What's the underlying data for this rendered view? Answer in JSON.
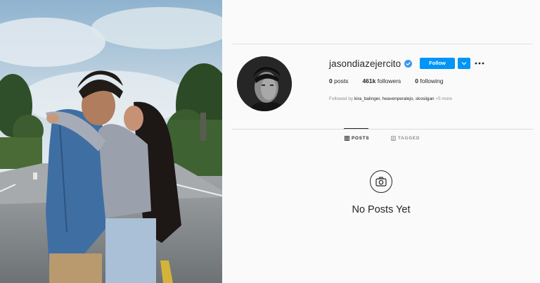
{
  "profile": {
    "username": "jasondiazejercito",
    "follow_label": "Follow",
    "stats": {
      "posts_count": "0",
      "posts_label": "posts",
      "followers_count": "461k",
      "followers_label": "followers",
      "following_count": "0",
      "following_label": "following"
    },
    "followed_by_prefix": "Followed by",
    "followed_by_names": "kira_balinger, heavenperalejo, skosiigan",
    "followed_by_more": "+5 more"
  },
  "tabs": [
    {
      "label": "POSTS",
      "active": true
    },
    {
      "label": "TAGGED",
      "active": false
    }
  ],
  "empty_state": {
    "title": "No Posts Yet"
  },
  "colors": {
    "accent": "#0095f6",
    "text": "#262626",
    "muted": "#8e8e8e",
    "background": "#fafafa"
  },
  "icons": [
    "verified-badge-icon",
    "chevron-down-icon",
    "more-options-icon",
    "grid-icon",
    "tag-icon",
    "camera-icon"
  ]
}
